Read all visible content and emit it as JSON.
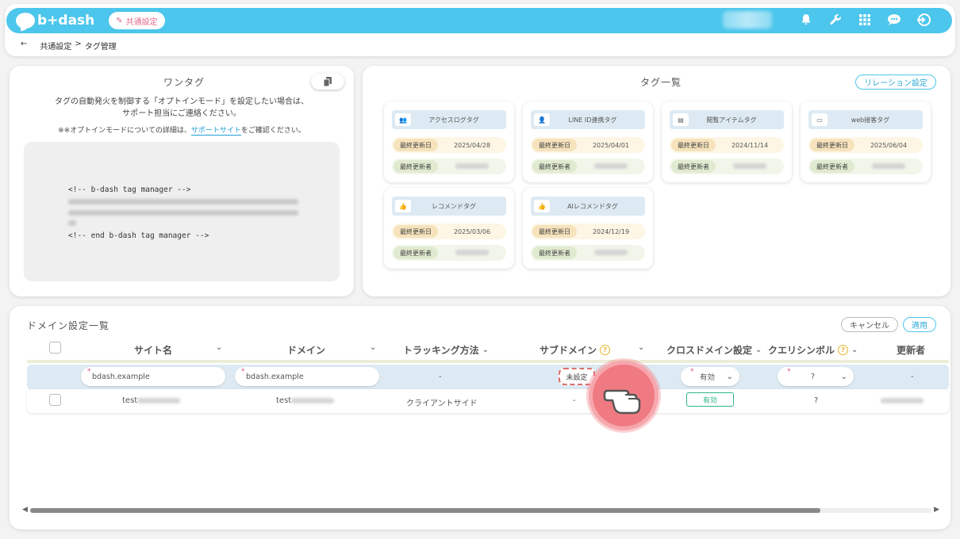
{
  "header": {
    "logo_text": "b+dash",
    "shared_settings_label": "共通設定",
    "icons": [
      "bell-icon",
      "wrench-icon",
      "grid-icon",
      "chat-icon",
      "logout-icon"
    ],
    "accent_color": "#4cc6ec"
  },
  "breadcrumb": {
    "back": "←",
    "parent": "共通設定",
    "separator": ">",
    "current": "タグ管理"
  },
  "onetag": {
    "title": "ワンタグ",
    "desc_line1": "タグの自動発火を制御する「オプトインモード」を設定したい場合は、",
    "desc_line2": "サポート担当にご連絡ください。",
    "note_prefix": "※※オプトインモードについての詳細は、",
    "note_link": "サポートサイト",
    "note_suffix": "をご確認ください。",
    "code_start": "<!-- b-dash tag manager -->",
    "code_end": "<!-- end b-dash tag manager -->"
  },
  "taglist": {
    "title": "タグ一覧",
    "relation_button": "リレーション設定",
    "date_label": "最終更新日",
    "user_label": "最終更新者",
    "tags": [
      {
        "name": "アクセスログタグ",
        "icon": "people-icon",
        "date": "2025/04/28"
      },
      {
        "name": "LINE ID連携タグ",
        "icon": "person-icon",
        "date": "2025/04/01"
      },
      {
        "name": "閲覧アイテムタグ",
        "icon": "list-icon",
        "date": "2024/11/14"
      },
      {
        "name": "web接客タグ",
        "icon": "monitor-icon",
        "date": "2025/06/04"
      },
      {
        "name": "レコメンドタグ",
        "icon": "thumbs-up-icon",
        "date": "2025/03/06"
      },
      {
        "name": "AIレコメンドタグ",
        "icon": "thumbs-up-icon",
        "date": "2024/12/19"
      }
    ]
  },
  "domain": {
    "title": "ドメイン設定一覧",
    "cancel_button": "キャンセル",
    "apply_button": "適用",
    "columns": {
      "site_name": "サイト名",
      "domain": "ドメイン",
      "tracking": "トラッキング方法",
      "subdomain": "サブドメイン",
      "cross_domain": "クロスドメイン設定",
      "query_symbol": "クエリシンボル",
      "updater": "更新者"
    },
    "edit_row": {
      "site_name": "bdash.example",
      "domain": "bdash.example",
      "tracking": "-",
      "subdomain": "未設定",
      "cross_domain": "有効",
      "query_symbol": "?",
      "updater": "-"
    },
    "data_row": {
      "site_name": "test",
      "domain": "test",
      "tracking": "クライアントサイド",
      "subdomain": "-",
      "cross_domain": "有効",
      "query_symbol": "?"
    }
  }
}
